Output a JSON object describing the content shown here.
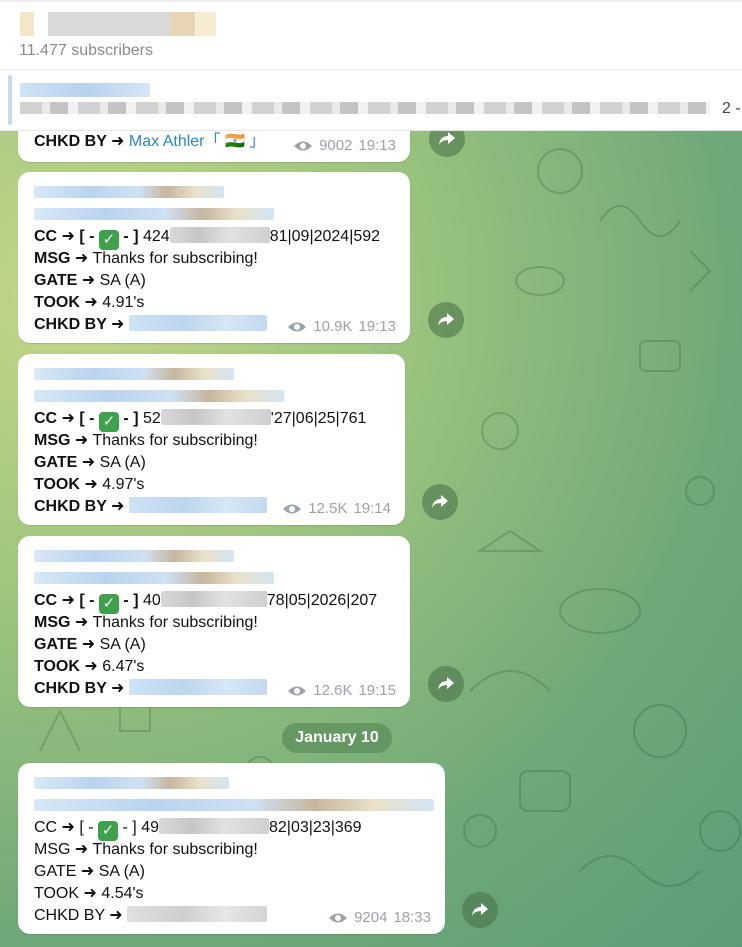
{
  "header": {
    "subscribers": "11.477 subscribers"
  },
  "pinned": {
    "counter": "2 -"
  },
  "messages": [
    {
      "chkd_label": "CHKD BY ➜",
      "chkd_name": "Max Athler「 🇮🇳 」",
      "views": "9002",
      "time": "19:13"
    },
    {
      "cc_label": "CC ➜ [ -",
      "cc_mid": "- ]",
      "cc_prefix": "424",
      "cc_suffix": "81|09|2024|592",
      "msg_label": "MSG ➜",
      "msg_value": "Thanks for subscribing!",
      "gate_label": "GATE ➜",
      "gate_value": "SA (A)",
      "took_label": "TOOK ➜",
      "took_value": "4.91's",
      "chkd_label": "CHKD BY ➜",
      "views": "10.9K",
      "time": "19:13"
    },
    {
      "cc_label": "CC ➜ [ -",
      "cc_mid": "- ]",
      "cc_prefix": "52",
      "cc_suffix": "'27|06|25|761",
      "msg_label": "MSG ➜",
      "msg_value": "Thanks for subscribing!",
      "gate_label": "GATE ➜",
      "gate_value": "SA (A)",
      "took_label": "TOOK ➜",
      "took_value": "4.97's",
      "chkd_label": "CHKD BY ➜",
      "views": "12.5K",
      "time": "19:14"
    },
    {
      "cc_label": "CC ➜ [ -",
      "cc_mid": "- ]",
      "cc_prefix": "40",
      "cc_suffix": "78|05|2026|207",
      "msg_label": "MSG ➜",
      "msg_value": "Thanks for subscribing!",
      "gate_label": "GATE ➜",
      "gate_value": "SA (A)",
      "took_label": "TOOK ➜",
      "took_value": "6.47's",
      "chkd_label": "CHKD BY ➜",
      "views": "12.6K",
      "time": "19:15"
    },
    {
      "cc_label": "CC ➜ [ -",
      "cc_mid": "- ]",
      "cc_prefix": "49",
      "cc_suffix": "82|03|23|369",
      "msg_label": "MSG ➜",
      "msg_value": "Thanks for subscribing!",
      "gate_label": "GATE ➜",
      "gate_value": "SA (A)",
      "took_label": "TOOK ➜",
      "took_value": "4.54's",
      "chkd_label": "CHKD BY ➜",
      "views": "9204",
      "time": "18:33"
    }
  ],
  "date_separator": "January 10",
  "icons": {
    "check": "✓",
    "eye": "eye-icon",
    "share": "share-icon"
  },
  "colors": {
    "link": "#2e86c8",
    "check_bg": "#3fa14b",
    "meta": "#9aa3ab"
  }
}
